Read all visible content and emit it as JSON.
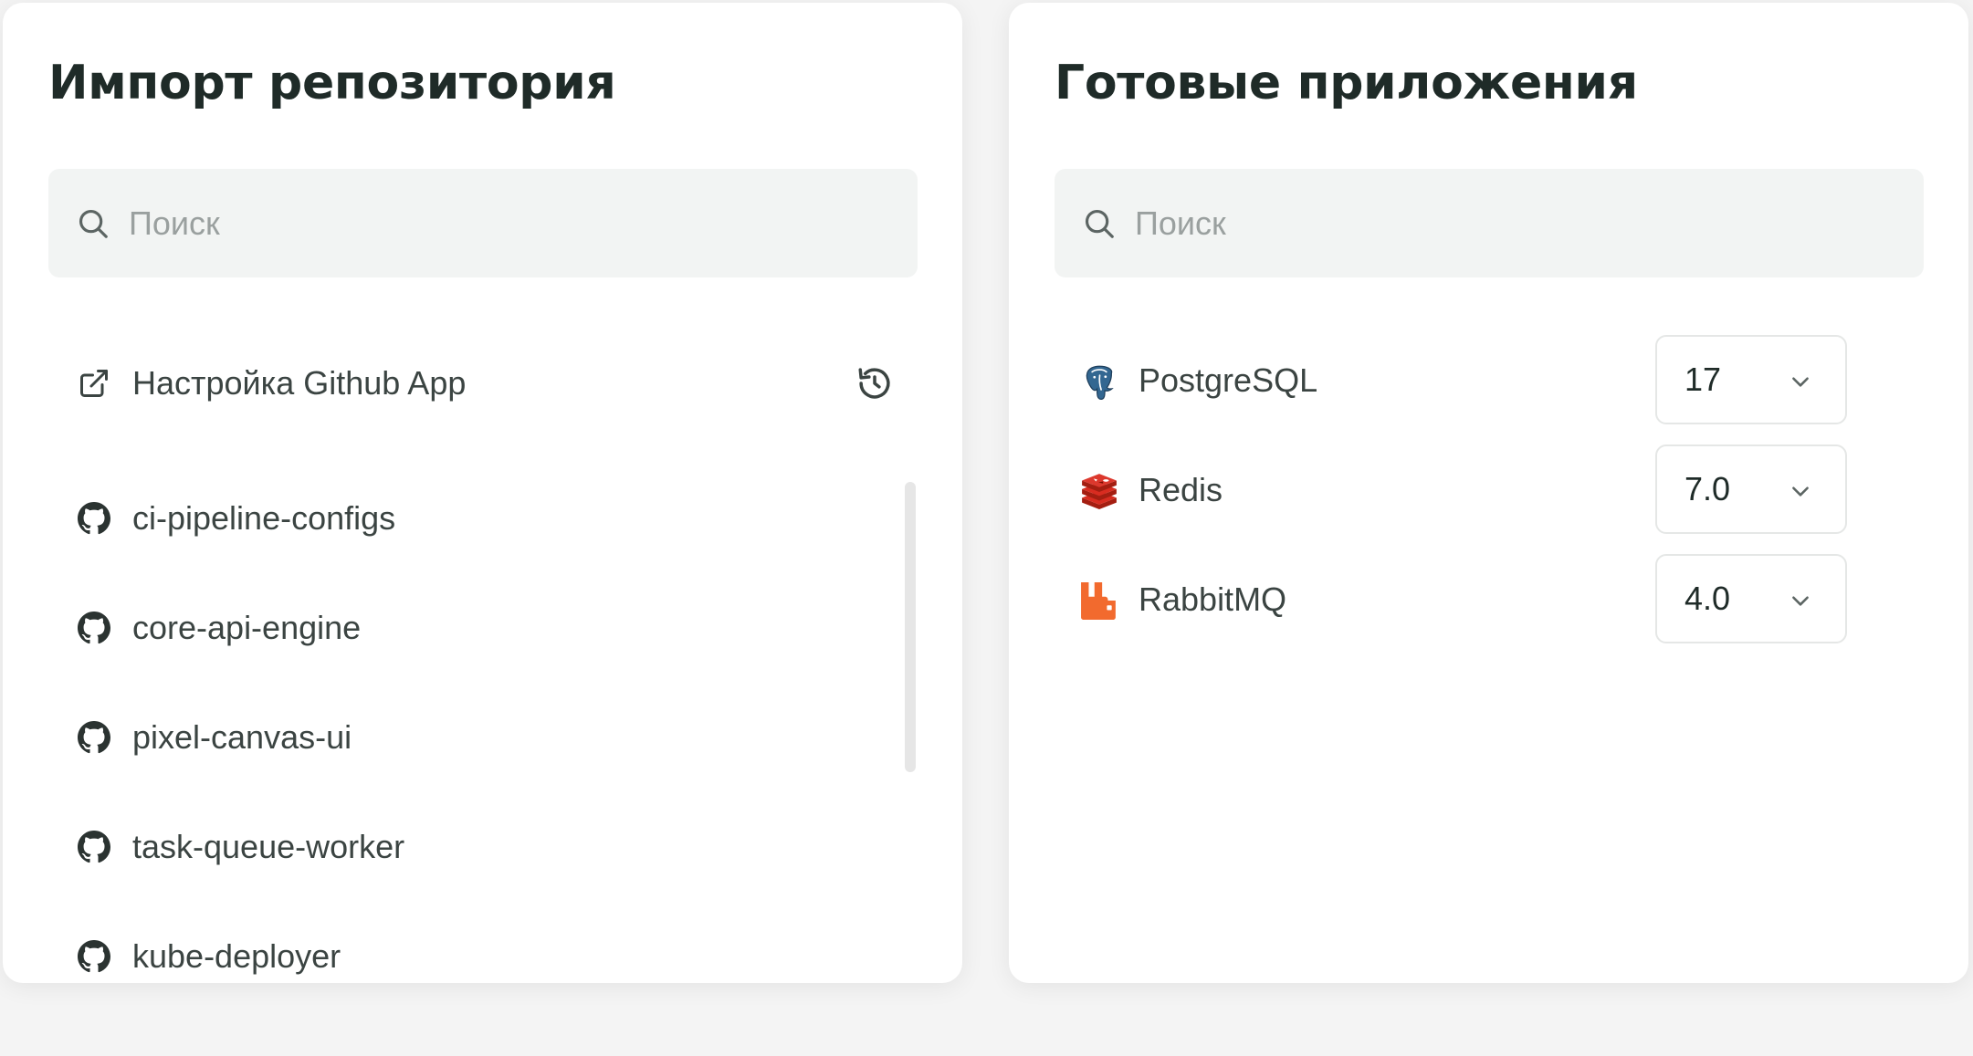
{
  "import_panel": {
    "title": "Импорт репозитория",
    "search": {
      "placeholder": "Поиск",
      "value": ""
    },
    "github_app_link": {
      "label": "Настройка Github App",
      "icon": "external-link-icon"
    },
    "refresh_icon": "refresh-icon",
    "repositories": [
      {
        "name": "ci-pipeline-configs",
        "icon": "github-icon"
      },
      {
        "name": "core-api-engine",
        "icon": "github-icon"
      },
      {
        "name": "pixel-canvas-ui",
        "icon": "github-icon"
      },
      {
        "name": "task-queue-worker",
        "icon": "github-icon"
      },
      {
        "name": "kube-deployer",
        "icon": "github-icon"
      }
    ]
  },
  "apps_panel": {
    "title": "Готовые приложения",
    "search": {
      "placeholder": "Поиск",
      "value": ""
    },
    "apps": [
      {
        "name": "PostgreSQL",
        "version": "17",
        "icon": "postgresql-icon",
        "color": "#336791"
      },
      {
        "name": "Redis",
        "version": "7.0",
        "icon": "redis-icon",
        "color": "#c6302b"
      },
      {
        "name": "RabbitMQ",
        "version": "4.0",
        "icon": "rabbitmq-icon",
        "color": "#f26a2e"
      }
    ]
  },
  "colors": {
    "page_background": "#f4f4f4",
    "panel_background": "#ffffff",
    "search_background": "#f2f4f3",
    "title_text": "#1f2b28",
    "body_text": "#3b4442",
    "placeholder_text": "#9aa09f"
  }
}
